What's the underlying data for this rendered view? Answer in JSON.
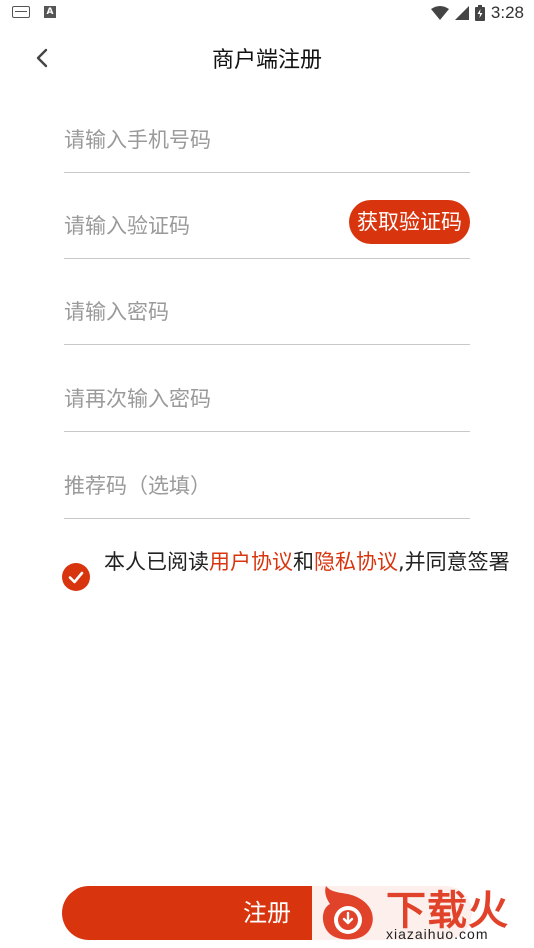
{
  "status_bar": {
    "time": "3:28"
  },
  "header": {
    "title": "商户端注册"
  },
  "form": {
    "phone_placeholder": "请输入手机号码",
    "code_placeholder": "请输入验证码",
    "get_code_label": "获取验证码",
    "password_placeholder": "请输入密码",
    "confirm_password_placeholder": "请再次输入密码",
    "referral_placeholder": "推荐码（选填）"
  },
  "agreement": {
    "checked": true,
    "prefix": "本人已阅读",
    "user_agreement": "用户协议",
    "conjunction": "和",
    "privacy_policy": "隐私协议",
    "suffix": ",并同意签署"
  },
  "register_label": "注册",
  "watermark": {
    "title": "下载火",
    "subtitle": "xiazaihuo.com"
  },
  "colors": {
    "accent": "#d8350f",
    "divider": "#c8c8c8",
    "placeholder": "#9a9a9a"
  }
}
